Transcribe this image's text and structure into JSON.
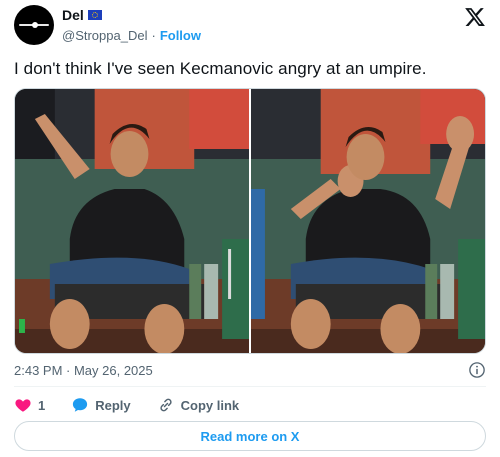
{
  "author": {
    "display_name": "Del",
    "handle": "@Stroppa_Del",
    "separator": "·",
    "follow_label": "Follow"
  },
  "tweet": {
    "text": "I don't think I've seen Kecmanovic angry at an umpire.",
    "timestamp": "2:43 PM · May 26, 2025"
  },
  "media": {
    "photos": [
      "player-pointing",
      "player-raised-hands"
    ]
  },
  "actions": {
    "like_count": "1",
    "reply_label": "Reply",
    "copy_link_label": "Copy link"
  },
  "footer": {
    "read_more_label": "Read more on X"
  },
  "colors": {
    "accent": "#1d9bf0",
    "like": "#f91880",
    "secondary_text": "#536471",
    "border": "#cfd9de"
  }
}
